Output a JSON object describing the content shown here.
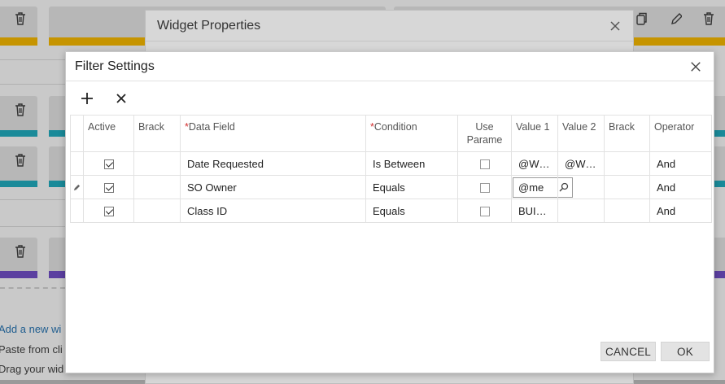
{
  "background": {
    "add_widget_link": "Add a new wi",
    "paste_text": "Paste from cli",
    "drag_text": "Drag your wid"
  },
  "widget_properties": {
    "title": "Widget Properties"
  },
  "filter_settings": {
    "title": "Filter Settings",
    "toolbar": {
      "add_icon": "plus-icon",
      "delete_icon": "x-icon"
    },
    "columns": [
      {
        "label": "Active",
        "required": false
      },
      {
        "label": "Brack",
        "required": false
      },
      {
        "label": "Data Field",
        "required": true
      },
      {
        "label": "Condition",
        "required": true
      },
      {
        "label": "Use Parame",
        "required": false
      },
      {
        "label": "Value 1",
        "required": false
      },
      {
        "label": "Value 2",
        "required": false
      },
      {
        "label": "Brack",
        "required": false
      },
      {
        "label": "Operator",
        "required": false
      }
    ],
    "rows": [
      {
        "active": true,
        "data_field": "Date Requested",
        "condition": "Is Between",
        "use_param": false,
        "value1": "@W…",
        "value2": "@W…",
        "operator": "And"
      },
      {
        "active": true,
        "data_field": "SO Owner",
        "condition": "Equals",
        "use_param": false,
        "value1": "@me",
        "value2": "",
        "operator": "And"
      },
      {
        "active": true,
        "data_field": "Class ID",
        "condition": "Equals",
        "use_param": false,
        "value1": "BUI…",
        "value2": "",
        "operator": "And"
      }
    ],
    "buttons": {
      "cancel": "CANCEL",
      "ok": "OK"
    }
  },
  "colors": {
    "gold": "#d49a00",
    "teal": "#1a8a99",
    "purple": "#5b3fa0",
    "required": "#d32f2f"
  }
}
